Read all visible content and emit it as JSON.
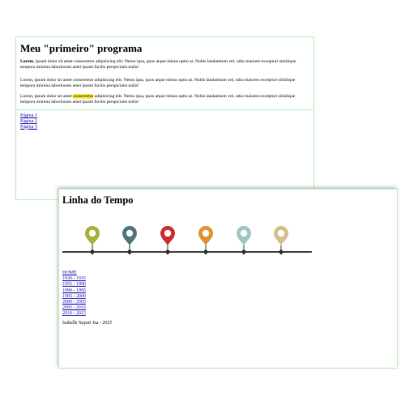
{
  "window1": {
    "title": "Meu \"primeiro\" programa",
    "paragraphs": [
      {
        "bold_lead": "Lorem",
        "text": ", ipsum dolor sit amet consectetur adipisicing elit. Nemo ipsa, quos atque minus optio at. Nobis laudantium vel, odio maiores excepturi similique tempora minima laboriosam amet ipsam facilis perspiciatis nulla!"
      },
      {
        "text": "Lorem, ipsum dolor sit amet consectetur adipisicing elit. Nemo ipsa, quos atque minus optio at. Nobis laudantium vel, odio maiores excepturi similique tempora minima laboriosam amet ipsam facilis perspiciatis nulla!"
      },
      {
        "before": "Lorem, ipsum dolor sit amet ",
        "highlight": "consectetur",
        "after": " adipisicing elit. Nemo ipsa, quos atque minus optio at. Nobis laudantium vel, odio maiores excepturi similique tempora minima laboriosam amet ipsam facilis perspiciatis nulla!"
      }
    ],
    "links": [
      "Página 1",
      "Página 2",
      "Página 3"
    ]
  },
  "window2": {
    "title": "Linha do Tempo",
    "pin_colors": [
      "#a9b03b",
      "#4f7480",
      "#c8312f",
      "#dc9630",
      "#9fc6c2",
      "#d6be8e"
    ],
    "links": [
      "HOME",
      "1930 - 1935",
      "1955 - 1990",
      "1990 - 1995",
      "1995 - 2000",
      "2000 - 2005",
      "2005 - 2010",
      "2010 - 2015"
    ],
    "footer": "Isabelle Sayuri Isa - 2025"
  },
  "colors": {
    "border": "#b8f0b8",
    "link": "#1a0dab",
    "highlight": "#ffef3a",
    "timeline_line": "#333333"
  }
}
